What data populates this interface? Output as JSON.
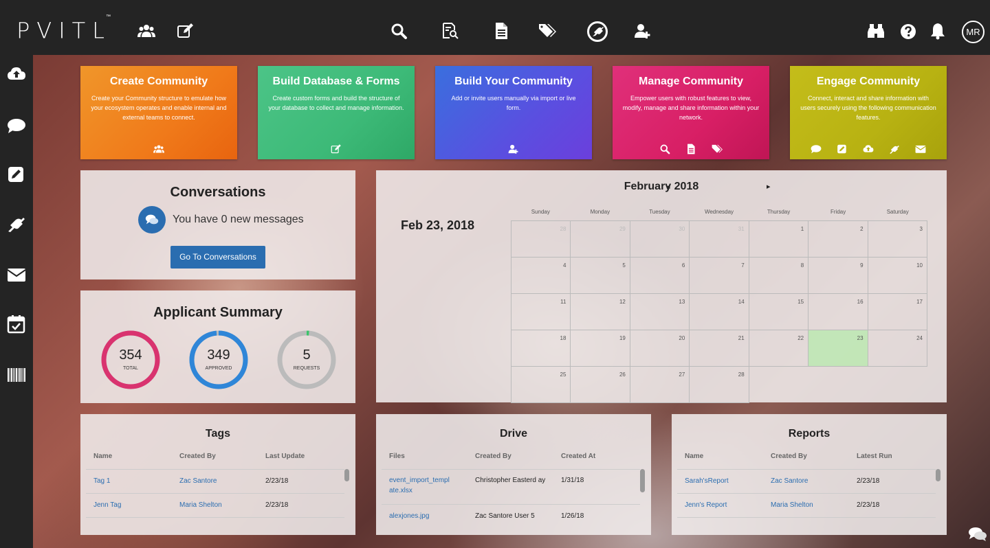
{
  "app": {
    "logo": "PVITL",
    "tm": "™",
    "user_initials": "MR"
  },
  "topbar_icons": [
    "users-icon",
    "edit-icon",
    "search-icon",
    "search-form-icon",
    "document-icon",
    "tags-icon",
    "plug-icon",
    "add-user-icon",
    "binoculars-icon",
    "help-icon",
    "bell-icon"
  ],
  "sidebar_icons": [
    "cloud-upload-icon",
    "chat-icon",
    "pencil-icon",
    "plug-icon",
    "mail-icon",
    "calendar-check-icon",
    "barcode-icon"
  ],
  "cards": [
    {
      "title": "Create Community",
      "desc": "Create your Community structure to emulate how your ecosystem operates and enable internal and external teams to connect.",
      "color": "#f07a1a"
    },
    {
      "title": "Build Database & Forms",
      "desc": "Create custom forms and build the structure of your database to collect and manage information.",
      "color": "#3dba78"
    },
    {
      "title": "Build Your Community",
      "desc": "Add or invite users manually via import or live form.",
      "color": "#5a4fe0"
    },
    {
      "title": "Manage Community",
      "desc": "Empower users with robust features to view, modify, manage and share information within your network.",
      "color": "#d81f65"
    },
    {
      "title": "Engage Community",
      "desc": "Connect, interact and share information with users securely using the following communication features.",
      "color": "#b8b212"
    }
  ],
  "conversations": {
    "title": "Conversations",
    "message": "You have 0 new messages",
    "button": "Go To Conversations"
  },
  "applicant_summary": {
    "title": "Applicant Summary",
    "stats": [
      {
        "value": "354",
        "label": "TOTAL",
        "color": "#d9336f",
        "fill": 1.0
      },
      {
        "value": "349",
        "label": "APPROVED",
        "color": "#2f86d8",
        "fill": 0.986
      },
      {
        "value": "5",
        "label": "REQUESTS",
        "color": "#3cc46a",
        "fill": 0.014
      }
    ]
  },
  "calendar": {
    "month": "February 2018",
    "prev": "◂",
    "next": "▸",
    "selected_date": "Feb 23, 2018",
    "days_of_week": [
      "Sunday",
      "Monday",
      "Tuesday",
      "Wednesday",
      "Thursday",
      "Friday",
      "Saturday"
    ],
    "cells": [
      "28",
      "29",
      "30",
      "31",
      "1",
      "2",
      "3",
      "4",
      "5",
      "6",
      "7",
      "8",
      "9",
      "10",
      "11",
      "12",
      "13",
      "14",
      "15",
      "16",
      "17",
      "18",
      "19",
      "20",
      "21",
      "22",
      "23",
      "24",
      "25",
      "26",
      "27",
      "28",
      "",
      "",
      ""
    ],
    "today": "23"
  },
  "tags": {
    "title": "Tags",
    "columns": [
      "Name",
      "Created By",
      "Last Update"
    ],
    "rows": [
      {
        "name": "Tag 1",
        "created_by": "Zac Santore",
        "date": "2/23/18"
      },
      {
        "name": "Jenn Tag",
        "created_by": "Maria Shelton",
        "date": "2/23/18"
      }
    ]
  },
  "drive": {
    "title": "Drive",
    "columns": [
      "Files",
      "Created By",
      "Created At"
    ],
    "rows": [
      {
        "name": "event_import_templ ate.xlsx",
        "created_by": "Christopher Easterd ay",
        "date": "1/31/18"
      },
      {
        "name": "alexjones.jpg",
        "created_by": "Zac Santore User 5",
        "date": "1/26/18"
      }
    ]
  },
  "reports": {
    "title": "Reports",
    "columns": [
      "Name",
      "Created By",
      "Latest Run"
    ],
    "rows": [
      {
        "name": "Sarah'sReport",
        "created_by": "Zac Santore",
        "date": "2/23/18"
      },
      {
        "name": "Jenn's Report",
        "created_by": "Maria Shelton",
        "date": "2/23/18"
      }
    ]
  }
}
